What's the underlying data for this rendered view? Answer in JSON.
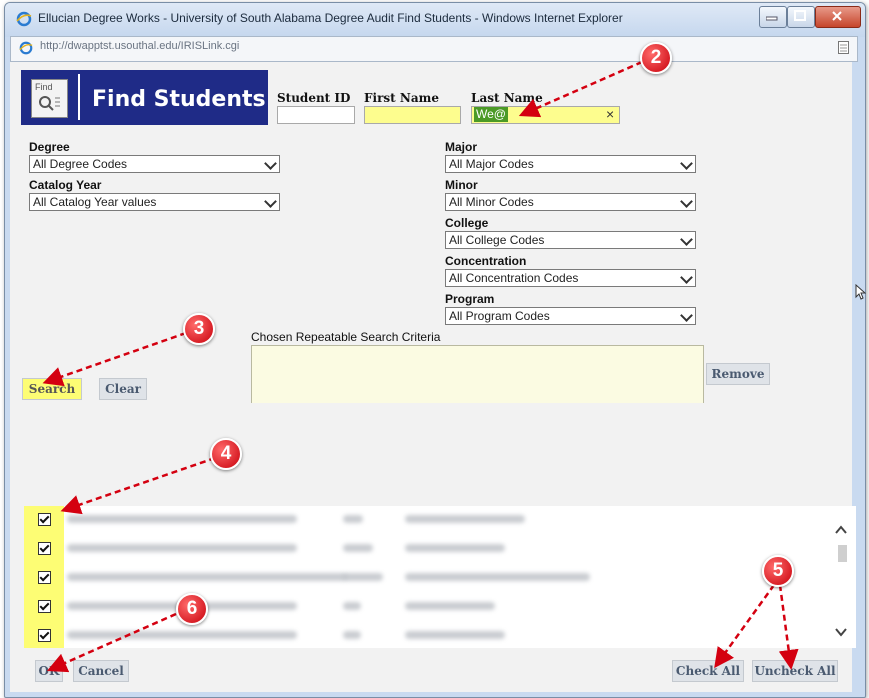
{
  "window": {
    "title": "Ellucian Degree Works - University of South Alabama Degree Audit Find Students - Windows Internet Explorer",
    "address": "http://dwapptst.usouthal.edu/IRISLink.cgi"
  },
  "find": {
    "icon_label": "Find",
    "title": "Find Students",
    "student_id_label": "Student ID",
    "first_name_label": "First Name",
    "last_name_label": "Last Name",
    "last_name_value": "We@",
    "clear_glyph": "×"
  },
  "filters": {
    "degree_label": "Degree",
    "degree_value": "All Degree Codes",
    "catalog_label": "Catalog Year",
    "catalog_value": "All Catalog Year values",
    "major_label": "Major",
    "major_value": "All Major Codes",
    "minor_label": "Minor",
    "minor_value": "All Minor Codes",
    "college_label": "College",
    "college_value": "All College Codes",
    "concentration_label": "Concentration",
    "concentration_value": "All Concentration Codes",
    "program_label": "Program",
    "program_value": "All Program Codes"
  },
  "search": {
    "chosen_label": "Chosen Repeatable Search Criteria",
    "search_button": "Search",
    "clear_button": "Clear",
    "remove_button": "Remove"
  },
  "results": {
    "rows": [
      {
        "checked": true
      },
      {
        "checked": true
      },
      {
        "checked": true
      },
      {
        "checked": true
      },
      {
        "checked": true
      }
    ]
  },
  "footer": {
    "ok_button": "OK",
    "cancel_button": "Cancel",
    "check_all_button": "Check All",
    "uncheck_all_button": "Uncheck All"
  },
  "callouts": [
    "2",
    "3",
    "4",
    "5",
    "6"
  ],
  "colors": {
    "header_blue": "#1f2b87",
    "highlight_yellow": "#fdfd74",
    "callout_red": "#c8000b"
  }
}
